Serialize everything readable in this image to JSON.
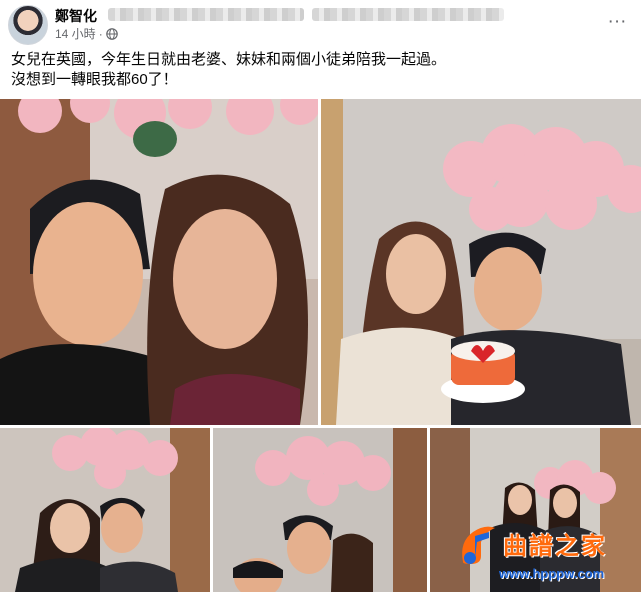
{
  "post": {
    "author": "鄭智化",
    "time": "14 小時",
    "separator": "·",
    "audience_icon": "globe-icon",
    "more_label": "···",
    "caption_line1": "女兒在英國，今年生日就由老婆、妹妹和兩個小徒弟陪我一起過。",
    "caption_line2": "沒想到一轉眼我都60了！"
  },
  "photos": [
    {
      "id": "p1",
      "subject": "selfie-couple"
    },
    {
      "id": "p2",
      "subject": "birthday-cake-couple"
    },
    {
      "id": "p3",
      "subject": "couple-flowers"
    },
    {
      "id": "p4",
      "subject": "group-selfie"
    },
    {
      "id": "p5",
      "subject": "group-photo"
    }
  ],
  "watermark": {
    "title": "曲譜之家",
    "url": "www.hpppw.com"
  },
  "colors": {
    "text": "#050505",
    "meta": "#65676b",
    "watermark_title": "#ff6a0d",
    "watermark_url": "#1f66d8"
  }
}
